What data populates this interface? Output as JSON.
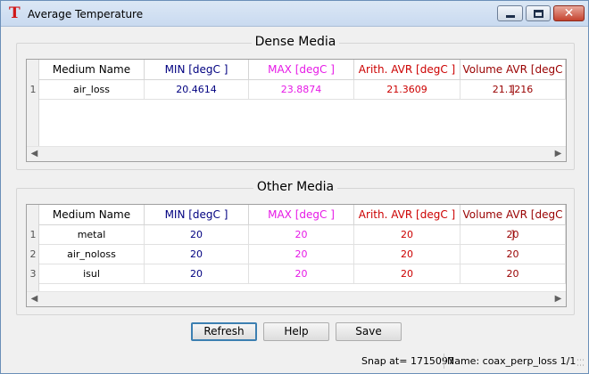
{
  "window": {
    "title": "Average Temperature",
    "app_icon_glyph": "T",
    "min_glyph": "minimize-icon",
    "max_glyph": "maximize-icon",
    "close_glyph": "✕"
  },
  "colors": {
    "medium": "#000000",
    "min": "#000080",
    "max": "#e619e6",
    "arith": "#cc0000",
    "volume": "#990000"
  },
  "columns": [
    "Medium Name",
    "MIN  [degC ]",
    "MAX  [degC ]",
    "Arith. AVR [degC ]",
    "Volume AVR [degC ]"
  ],
  "dense_media": {
    "title": "Dense Media",
    "rows": [
      {
        "n": "1",
        "name": "air_loss",
        "min": "20.4614",
        "max": "23.8874",
        "arith": "21.3609",
        "volume": "21.1216"
      }
    ]
  },
  "other_media": {
    "title": "Other Media",
    "rows": [
      {
        "n": "1",
        "name": "metal",
        "min": "20",
        "max": "20",
        "arith": "20",
        "volume": "20"
      },
      {
        "n": "2",
        "name": "air_noloss",
        "min": "20",
        "max": "20",
        "arith": "20",
        "volume": "20"
      },
      {
        "n": "3",
        "name": "isul",
        "min": "20",
        "max": "20",
        "arith": "20",
        "volume": "20"
      }
    ]
  },
  "buttons": {
    "refresh": "Refresh",
    "help": "Help",
    "save": "Save"
  },
  "status": {
    "snap": "Snap at= 1715097",
    "name": "Name:  coax_perp_loss 1/1"
  }
}
